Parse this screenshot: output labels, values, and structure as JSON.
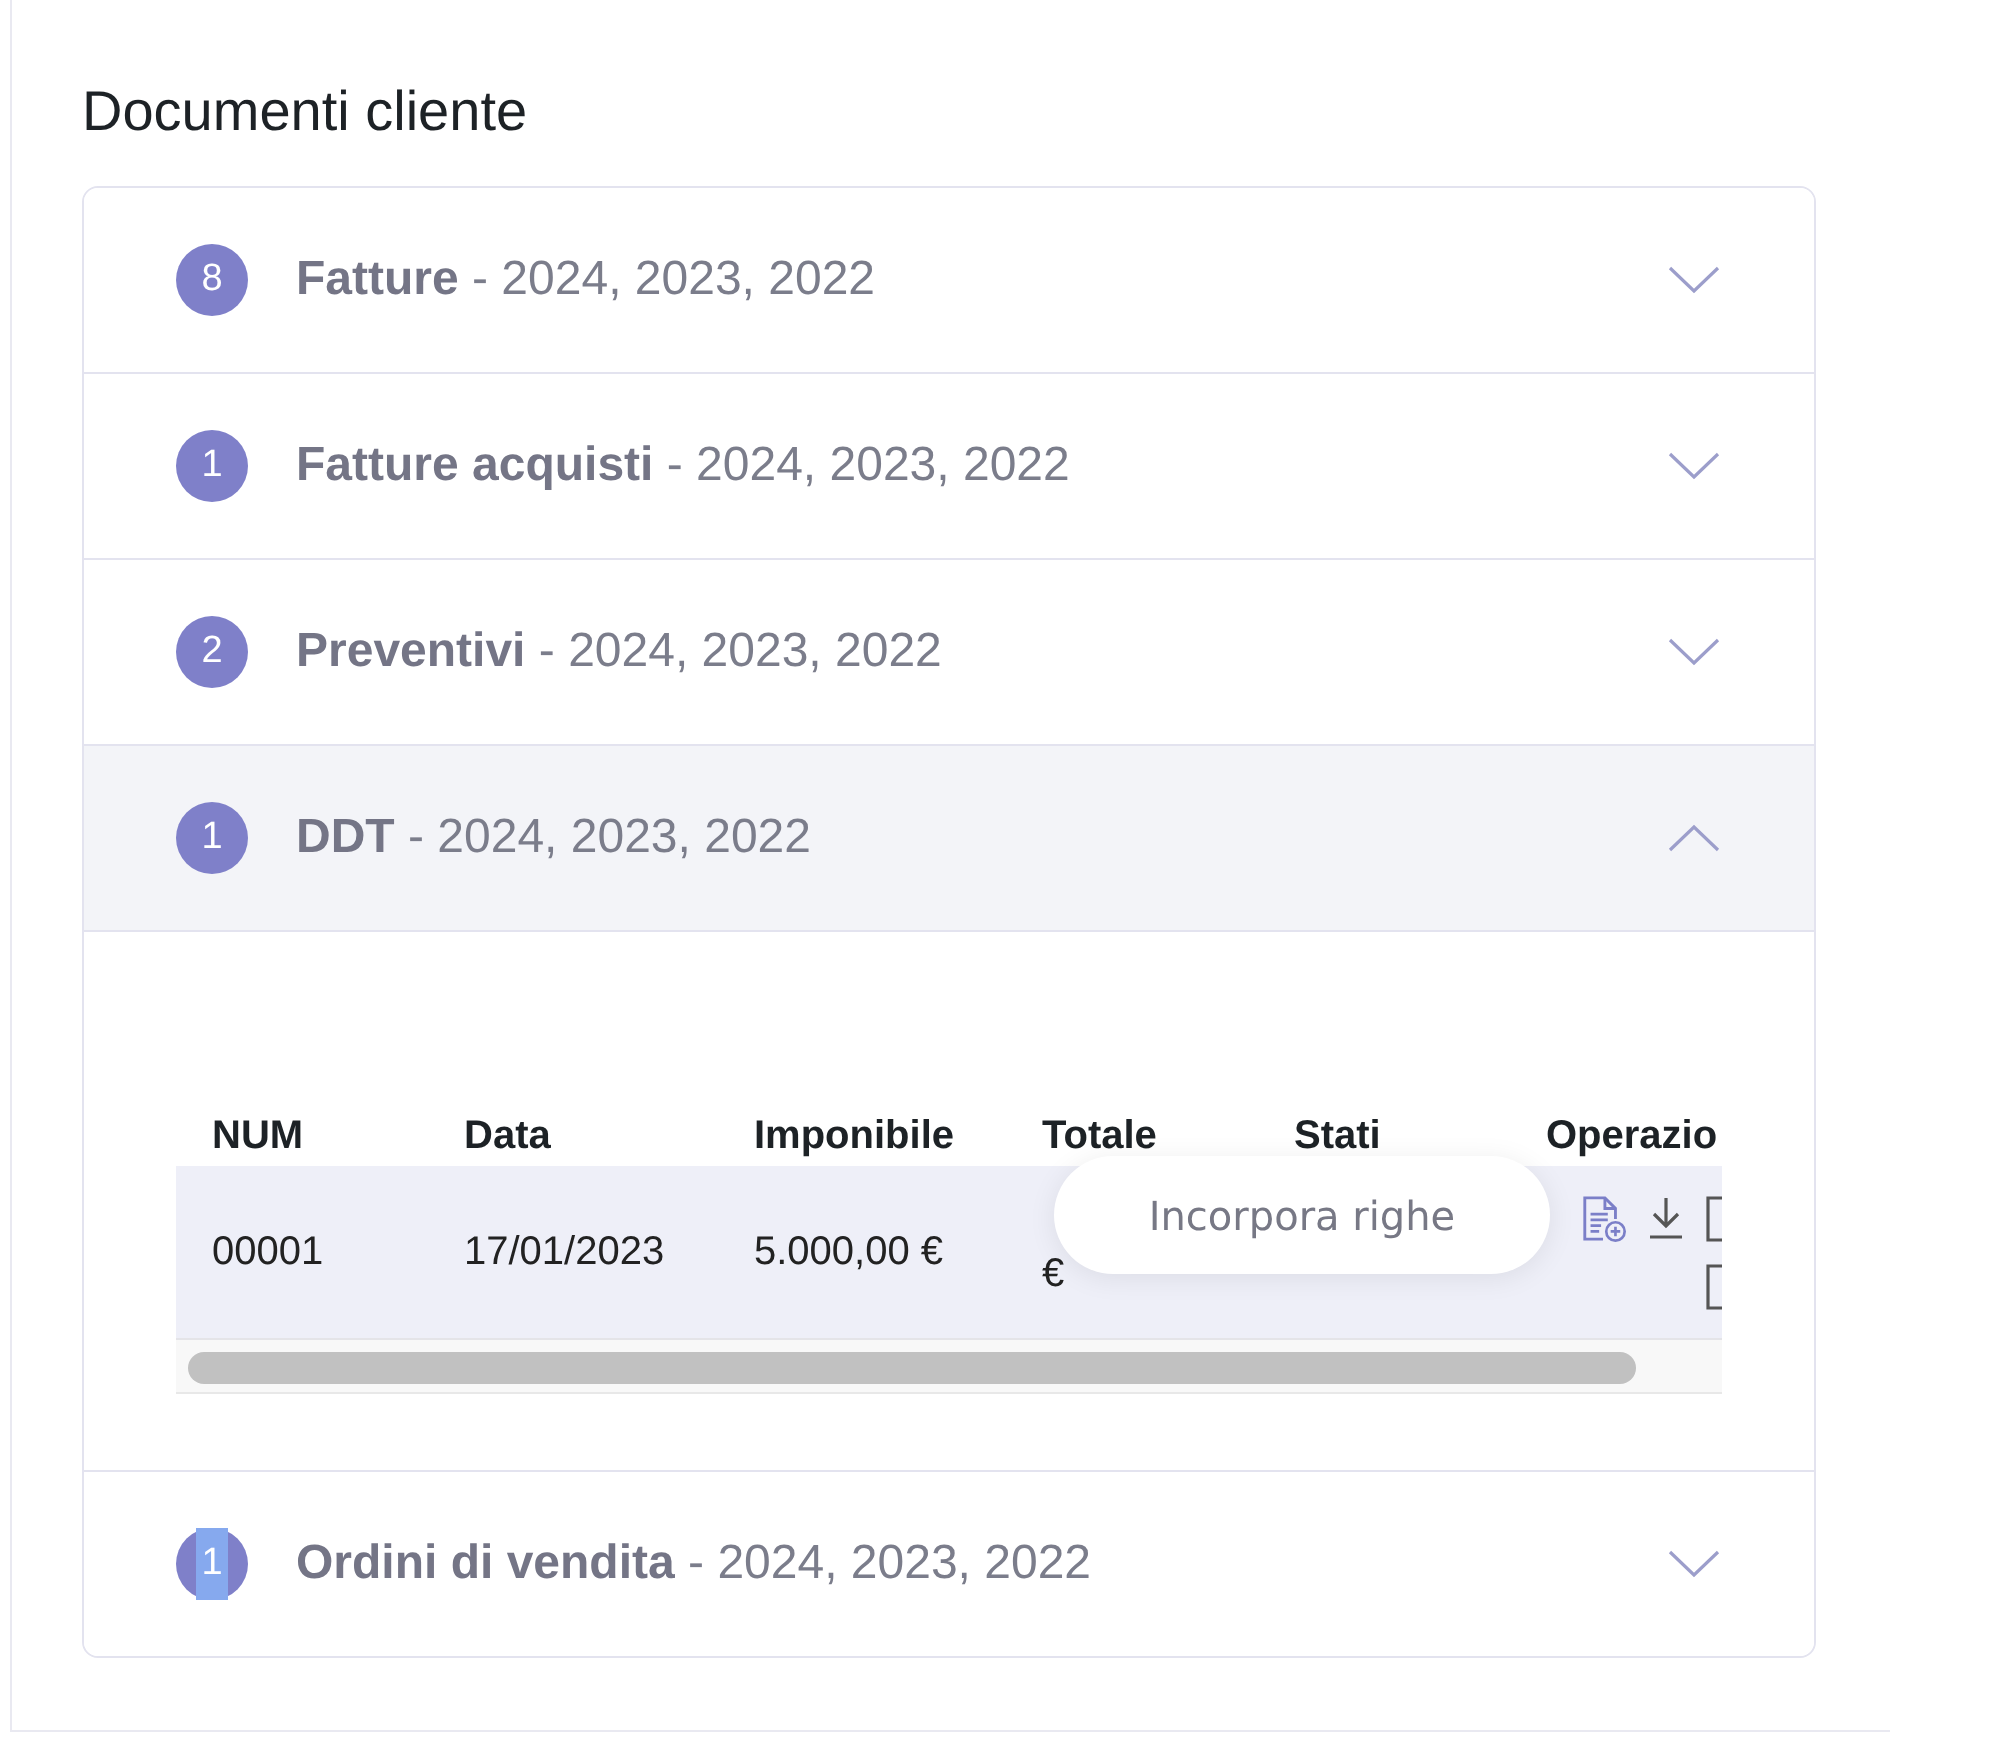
{
  "title": "Documenti cliente",
  "sections": [
    {
      "count": "8",
      "label": "**Fatture** - 2024, 2023, 2022",
      "expanded": false,
      "count_selected": false
    },
    {
      "count": "1",
      "label": "**Fatture acquisti** - 2024, 2023, 2022",
      "expanded": false,
      "count_selected": false
    },
    {
      "count": "2",
      "label": "**Preventivi** - 2024, 2023, 2022",
      "expanded": false,
      "count_selected": false
    },
    {
      "count": "1",
      "label": "**DDT** - 2024, 2023, 2022",
      "expanded": true,
      "count_selected": false,
      "table": {
        "columns": [
          "NUM",
          "Data",
          "Imponibile",
          "Totale",
          "Stati",
          "Operazio"
        ],
        "rows": [
          {
            "cells": [
              "00001",
              "17/01/2023",
              "5.000,00 €",
              "€"
            ],
            "actions": [
              {
                "kind": "add-document",
                "hovered": true,
                "tooltip": "Incorpora righe"
              },
              {
                "kind": "download",
                "hovered": false
              },
              {
                "kind": "partial-square",
                "hovered": false
              },
              {
                "kind": "partial-square",
                "hovered": false
              }
            ]
          }
        ]
      }
    },
    {
      "count": "1",
      "label": "**Ordini di vendita** - 2024, 2023, 2022",
      "expanded": false,
      "count_selected": true
    }
  ]
}
